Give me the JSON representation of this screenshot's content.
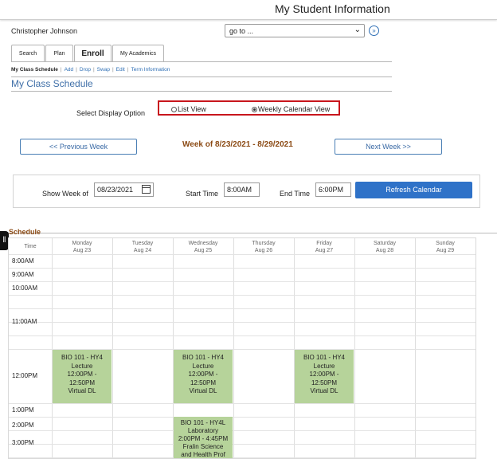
{
  "header": {
    "title": "My Student Information"
  },
  "user": {
    "name": "Christopher Johnson"
  },
  "goto": {
    "label": "go to ..."
  },
  "tabs": [
    {
      "label": "Search"
    },
    {
      "label": "Plan"
    },
    {
      "label": "Enroll"
    },
    {
      "label": "My Academics"
    }
  ],
  "subnav": [
    {
      "label": "My Class Schedule"
    },
    {
      "label": "Add"
    },
    {
      "label": "Drop"
    },
    {
      "label": "Swap"
    },
    {
      "label": "Edit"
    },
    {
      "label": "Term Information"
    }
  ],
  "page": {
    "title": "My Class Schedule"
  },
  "display": {
    "label": "Select Display Option",
    "options": [
      {
        "label": "List View",
        "selected": false
      },
      {
        "label": "Weekly Calendar View",
        "selected": true
      }
    ]
  },
  "week": {
    "prev_label": "<< Previous Week",
    "next_label": "Next Week >>",
    "title": "Week of 8/23/2021 - 8/29/2021"
  },
  "filters": {
    "show_week_label": "Show Week of",
    "show_week_value": "08/23/2021",
    "start_label": "Start Time",
    "start_value": "8:00AM",
    "end_label": "End Time",
    "end_value": "6:00PM",
    "refresh_label": "Refresh Calendar"
  },
  "schedule": {
    "label": "Schedule",
    "time_header": "Time",
    "days": [
      {
        "day": "Monday",
        "date": "Aug 23"
      },
      {
        "day": "Tuesday",
        "date": "Aug 24"
      },
      {
        "day": "Wednesday",
        "date": "Aug 25"
      },
      {
        "day": "Thursday",
        "date": "Aug 26"
      },
      {
        "day": "Friday",
        "date": "Aug 27"
      },
      {
        "day": "Saturday",
        "date": "Aug 28"
      },
      {
        "day": "Sunday",
        "date": "Aug 29"
      }
    ],
    "times": [
      "8:00AM",
      "9:00AM",
      "10:00AM",
      "11:00AM",
      "12:00PM",
      "1:00PM",
      "2:00PM",
      "3:00PM"
    ],
    "events": [
      {
        "day": "Monday",
        "lines": [
          "BIO 101 - HY4",
          "Lecture",
          "12:00PM -",
          "12:50PM",
          "Virtual DL"
        ]
      },
      {
        "day": "Wednesday",
        "lines": [
          "BIO 101 - HY4",
          "Lecture",
          "12:00PM -",
          "12:50PM",
          "Virtual DL"
        ]
      },
      {
        "day": "Friday",
        "lines": [
          "BIO 101 - HY4",
          "Lecture",
          "12:00PM -",
          "12:50PM",
          "Virtual DL"
        ]
      },
      {
        "day": "Wednesday",
        "lines": [
          "BIO 101 - HY4L",
          "Laboratory",
          "2:00PM - 4:45PM",
          "Fralin Science",
          "and Health Prof"
        ]
      }
    ],
    "colors": {
      "event": "#b6d39a",
      "week_title": "#8b4a14",
      "accent": "#2f72c8",
      "highlight": "#c8161d"
    }
  }
}
